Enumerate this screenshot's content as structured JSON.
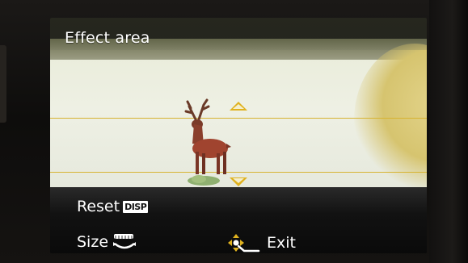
{
  "screen": {
    "title": "Effect area",
    "reset_label": "Reset",
    "reset_button_badge": "DISP",
    "size_label": "Size",
    "exit_label": "Exit"
  },
  "icons": {
    "up_arrow": "triangle-up-icon",
    "down_arrow": "triangle-down-icon",
    "rear_dial": "rear-dial-icon",
    "cursor_pad": "cursor-pad-icon"
  },
  "colors": {
    "accent_yellow": "#e0b21f",
    "guide_line": "#d7b331",
    "text": "#ffffff"
  }
}
